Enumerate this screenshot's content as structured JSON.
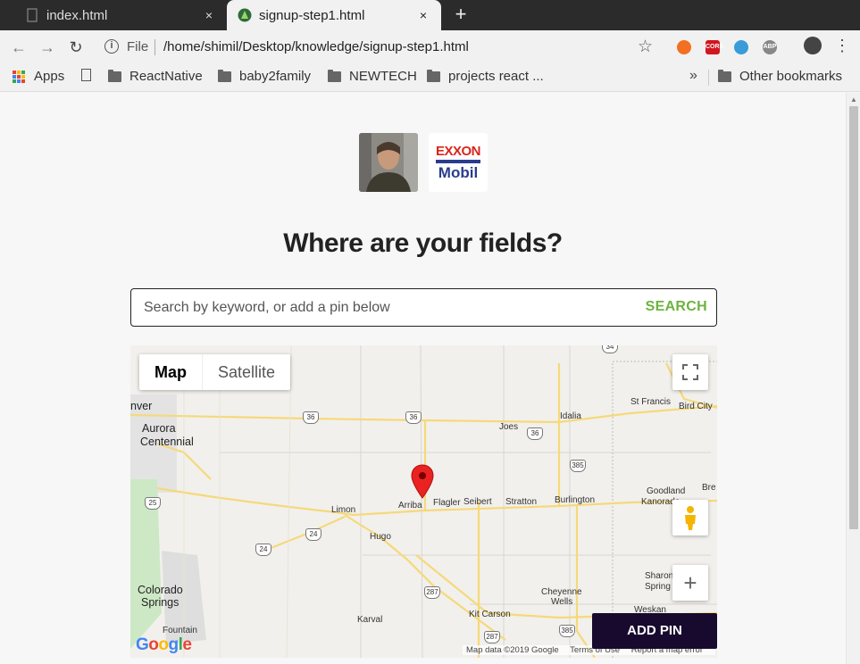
{
  "browser": {
    "tabs": [
      {
        "title": "index.html",
        "active": false
      },
      {
        "title": "signup-step1.html",
        "active": true
      }
    ],
    "close_glyph": "×",
    "new_tab_glyph": "+",
    "address": {
      "scheme_label": "File",
      "url": "/home/shimil/Desktop/knowledge/signup-step1.html"
    },
    "extensions": [
      {
        "icon": "orange-ring-icon",
        "color": "#f36f21"
      },
      {
        "icon": "cors-icon",
        "label": "CORS",
        "color": "#d2161f"
      },
      {
        "icon": "blue-circle-icon",
        "color": "#3a9bd9"
      },
      {
        "icon": "abp-icon",
        "label": "ABP",
        "color": "#888888"
      }
    ],
    "bookmarks": [
      {
        "label": "Apps",
        "icon": "apps-grid-icon"
      },
      {
        "label": "",
        "icon": "page-icon"
      },
      {
        "label": "ReactNative",
        "icon": "folder-icon"
      },
      {
        "label": "baby2family",
        "icon": "folder-icon"
      },
      {
        "label": "NEWTECH",
        "icon": "folder-icon"
      },
      {
        "label": "projects react ...",
        "icon": "folder-icon"
      }
    ],
    "overflow_glyph": "»",
    "other_bookmarks": "Other bookmarks"
  },
  "page": {
    "brand_logo": {
      "line1": "EXXON",
      "line2": "Mobil"
    },
    "heading": "Where are your fields?",
    "search": {
      "placeholder": "Search by keyword, or add a pin below",
      "value": "",
      "button": "SEARCH"
    },
    "accent_color": "#6db33f",
    "map": {
      "type_controls": {
        "map": "Map",
        "satellite": "Satellite",
        "selected": "Map"
      },
      "places": [
        "nver",
        "Aurora",
        "Centennial",
        "Limon",
        "Hugo",
        "Arriba",
        "Flagler",
        "Seibert",
        "Stratton",
        "Burlington",
        "Kanorado",
        "Goodland",
        "Bre",
        "Joes",
        "Idalia",
        "St Francis",
        "Bird City",
        "Colorado",
        "Springs",
        "Fountain",
        "Karval",
        "Kit Carson",
        "Cheyenne",
        "Wells",
        "Sharon",
        "Spring",
        "Weskan"
      ],
      "route_shields": [
        "36",
        "36",
        "36",
        "34",
        "385",
        "24",
        "24",
        "287",
        "287",
        "385",
        "25"
      ],
      "zoom_in_glyph": "+",
      "attribution": {
        "logo": "Google",
        "data": "Map data ©2019 Google",
        "terms": "Terms of Use",
        "report": "Report a map error"
      },
      "add_pin": "ADD PIN"
    }
  }
}
